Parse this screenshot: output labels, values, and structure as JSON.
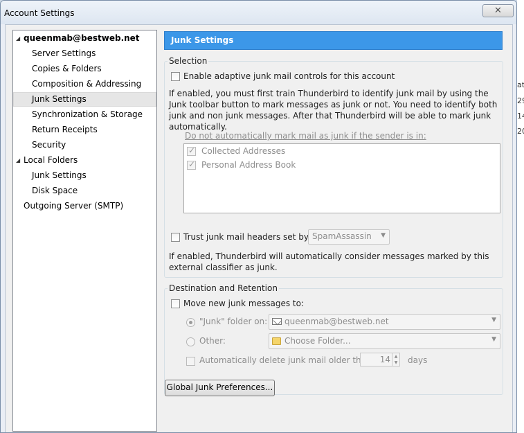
{
  "window": {
    "title": "Account Settings",
    "close_glyph": "✕"
  },
  "tree": {
    "account": "queenmab@bestweb.net",
    "account_items": [
      "Server Settings",
      "Copies & Folders",
      "Composition & Addressing",
      "Junk Settings",
      "Synchronization & Storage",
      "Return Receipts",
      "Security"
    ],
    "local_folders": "Local Folders",
    "local_items": [
      "Junk Settings",
      "Disk Space"
    ],
    "outgoing": "Outgoing Server (SMTP)"
  },
  "panel": {
    "header": "Junk Settings",
    "selection": {
      "legend": "Selection",
      "enable_label": "Enable adaptive junk mail controls for this account",
      "description": "If enabled, you must first train Thunderbird to identify junk mail by using the Junk toolbar button to mark messages as junk or not. You need to identify both junk and non junk messages. After that Thunderbird will be able to mark junk automatically.",
      "whitelist_label": "Do not automatically mark mail as junk if the sender is in:",
      "whitelist_items": [
        "Collected Addresses",
        "Personal Address Book"
      ],
      "trust_label": "Trust junk mail headers set by:",
      "trust_value": "SpamAssassin",
      "trust_description": "If enabled, Thunderbird will automatically consider messages marked by this external classifier as junk."
    },
    "destination": {
      "legend": "Destination and Retention",
      "move_label": "Move new junk messages to:",
      "junk_folder_label": "\"Junk\" folder on:",
      "junk_folder_value": "queenmab@bestweb.net",
      "other_label": "Other:",
      "other_value": "Choose Folder...",
      "auto_delete_label": "Automatically delete junk mail older than",
      "days_value": "14",
      "days_label": "days"
    },
    "global_button": "Global Junk Preferences..."
  },
  "right_strip": [
    "ate",
    "29",
    "14",
    "20"
  ]
}
